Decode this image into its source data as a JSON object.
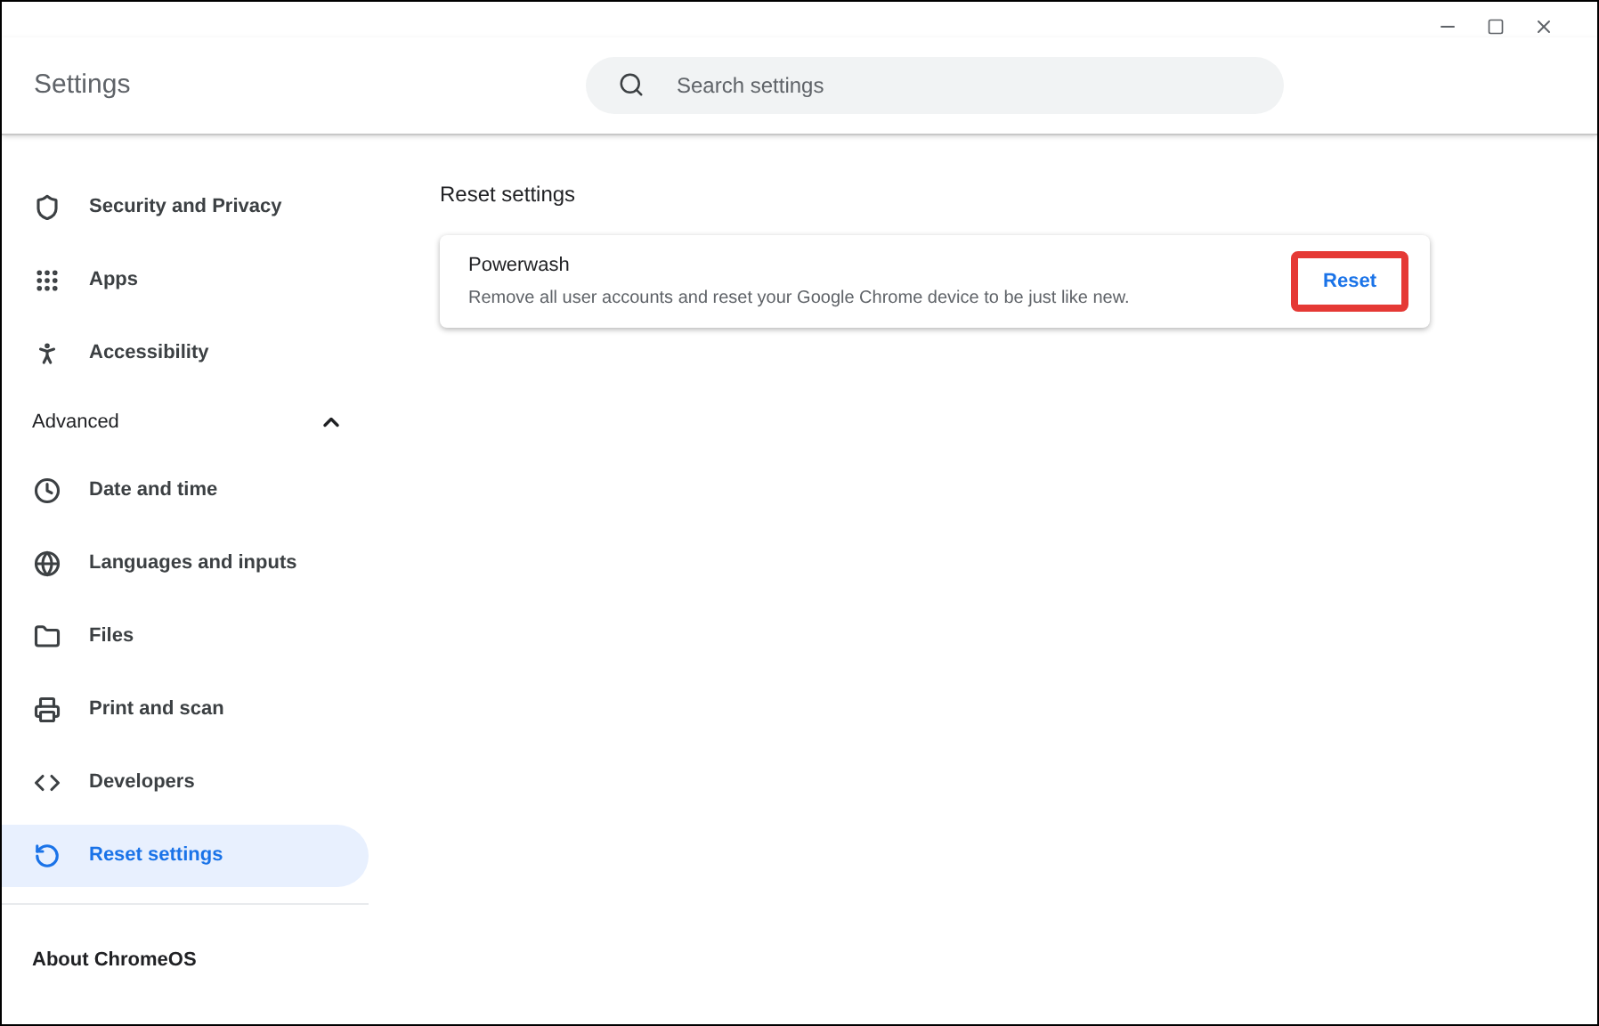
{
  "window": {
    "title": "Settings"
  },
  "search": {
    "placeholder": "Search settings"
  },
  "sidebar": {
    "items": [
      {
        "kind": "item",
        "label": "Security and Privacy",
        "selected": false
      },
      {
        "kind": "item",
        "label": "Apps",
        "selected": false
      },
      {
        "kind": "item",
        "label": "Accessibility",
        "selected": false
      },
      {
        "kind": "section",
        "label": "Advanced",
        "expanded": true
      },
      {
        "kind": "item",
        "label": "Date and time",
        "selected": false
      },
      {
        "kind": "item",
        "label": "Languages and inputs",
        "selected": false
      },
      {
        "kind": "item",
        "label": "Files",
        "selected": false
      },
      {
        "kind": "item",
        "label": "Print and scan",
        "selected": false
      },
      {
        "kind": "item",
        "label": "Developers",
        "selected": false
      },
      {
        "kind": "item",
        "label": "Reset settings",
        "selected": true
      },
      {
        "kind": "link",
        "label": "About ChromeOS"
      }
    ]
  },
  "content": {
    "heading": "Reset settings",
    "card": {
      "title": "Powerwash",
      "description": "Remove all user accounts and reset your Google Chrome device to be just like new.",
      "button": {
        "label": "Reset",
        "highlighted": true
      }
    }
  }
}
